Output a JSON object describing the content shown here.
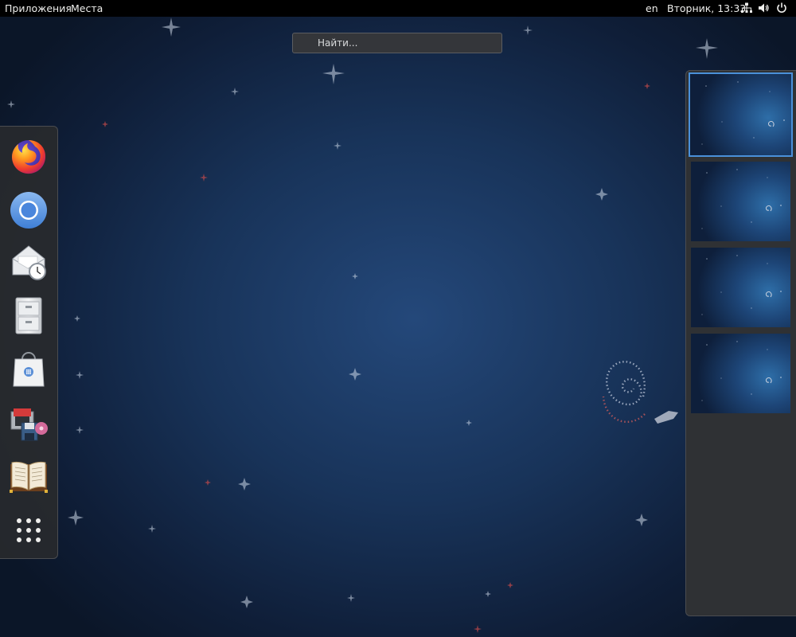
{
  "top_bar": {
    "applications": "Приложения",
    "places": "Места",
    "language": "en",
    "clock": "Вторник, 13:33",
    "icons": [
      "network-icon",
      "volume-icon",
      "power-icon"
    ]
  },
  "search": {
    "placeholder": "Найти..."
  },
  "dash": {
    "items": [
      {
        "name": "firefox-icon"
      },
      {
        "name": "chromium-icon"
      },
      {
        "name": "evolution-mail-icon"
      },
      {
        "name": "files-icon"
      },
      {
        "name": "software-icon"
      },
      {
        "name": "tools-icon"
      },
      {
        "name": "book-icon"
      },
      {
        "name": "show-applications-icon"
      }
    ]
  },
  "workspaces": {
    "count": 4,
    "active_index": 0
  },
  "colors": {
    "top_bar": "#000000",
    "accent": "#4a90d9",
    "panel": "#2f3134"
  }
}
